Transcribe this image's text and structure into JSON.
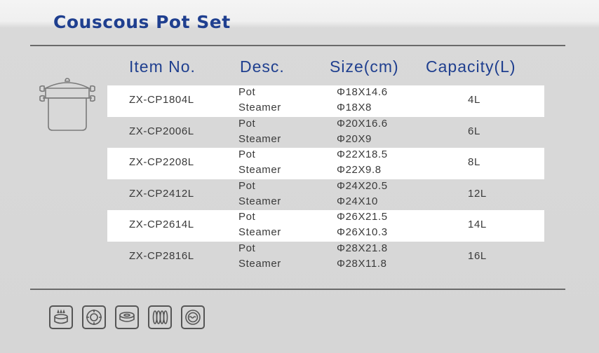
{
  "title": "Couscous Pot Set",
  "headers": {
    "item": "Item No.",
    "desc": "Desc.",
    "size": "Size(cm)",
    "capacity": "Capacity(L)"
  },
  "rows": [
    {
      "item": "ZX-CP1804L",
      "desc1": "Pot",
      "desc2": "Steamer",
      "size1": "Φ18X14.6",
      "size2": "Φ18X8",
      "capacity": "4L"
    },
    {
      "item": "ZX-CP2006L",
      "desc1": "Pot",
      "desc2": "Steamer",
      "size1": "Φ20X16.6",
      "size2": "Φ20X9",
      "capacity": "6L"
    },
    {
      "item": "ZX-CP2208L",
      "desc1": "Pot",
      "desc2": "Steamer",
      "size1": "Φ22X18.5",
      "size2": "Φ22X9.8",
      "capacity": "8L"
    },
    {
      "item": "ZX-CP2412L",
      "desc1": "Pot",
      "desc2": "Steamer",
      "size1": "Φ24X20.5",
      "size2": "Φ24X10",
      "capacity": "12L"
    },
    {
      "item": "ZX-CP2614L",
      "desc1": "Pot",
      "desc2": "Steamer",
      "size1": "Φ26X21.5",
      "size2": "Φ26X10.3",
      "capacity": "14L"
    },
    {
      "item": "ZX-CP2816L",
      "desc1": "Pot",
      "desc2": "Steamer",
      "size1": "Φ28X21.8",
      "size2": "Φ28X11.8",
      "capacity": "16L"
    }
  ],
  "cooktop_icons": [
    "gas-stove-icon",
    "electric-hob-icon",
    "ceramic-hob-icon",
    "halogen-icon",
    "induction-icon"
  ],
  "colors": {
    "title": "#1f3f8f",
    "text": "#3a3a3a",
    "row_highlight": "#ffffff"
  }
}
